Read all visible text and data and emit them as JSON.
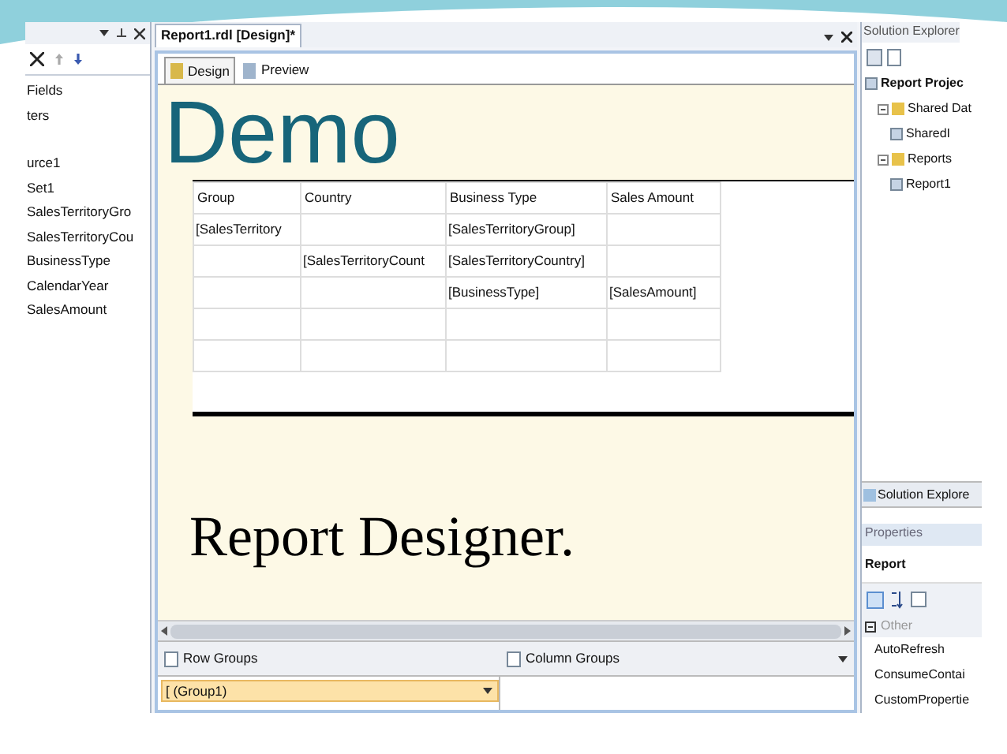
{
  "slide": {
    "title": "Demo",
    "subtitle": "Report Designer."
  },
  "report_data": {
    "items": [
      "Fields",
      "ters",
      "urce1",
      "Set1",
      "SalesTerritoryGro",
      "SalesTerritoryCou",
      "BusinessType",
      "CalendarYear",
      "SalesAmount"
    ]
  },
  "document_tab": {
    "title": "Report1.rdl [Design]*"
  },
  "view_tabs": [
    {
      "label": "Design",
      "selected": true
    },
    {
      "label": "Preview",
      "selected": false
    }
  ],
  "table": {
    "columns": [
      "Group",
      "Country",
      "Business Type",
      "Sales Amount"
    ],
    "rows": [
      [
        "[SalesTerritory",
        "",
        "[SalesTerritoryGroup]",
        ""
      ],
      [
        "",
        "[SalesTerritoryCount",
        "[SalesTerritoryCountry]",
        ""
      ],
      [
        "",
        "",
        "[BusinessType]",
        "[SalesAmount]"
      ],
      [
        "",
        "",
        "",
        ""
      ],
      [
        "",
        "",
        "",
        ""
      ]
    ]
  },
  "grouping": {
    "row_groups": "Row Groups",
    "column_groups": "Column Groups",
    "row_group_items": [
      {
        "label": "[ (Group1)",
        "selected": true
      }
    ]
  },
  "solution_explorer": {
    "title": "Solution Explorer",
    "tree": [
      {
        "label": "Report Projec",
        "children": [
          {
            "label": "Shared Dat",
            "expanded": true,
            "children": [
              {
                "label": "SharedI"
              }
            ]
          },
          {
            "label": "Reports",
            "expanded": true,
            "children": [
              {
                "label": "Report1"
              }
            ]
          }
        ]
      }
    ],
    "tab": "Solution Explore"
  },
  "properties": {
    "title": "Properties",
    "object": "Report",
    "category": "Other",
    "items": [
      "AutoRefresh",
      "ConsumeContai",
      "CustomPropertie"
    ]
  }
}
